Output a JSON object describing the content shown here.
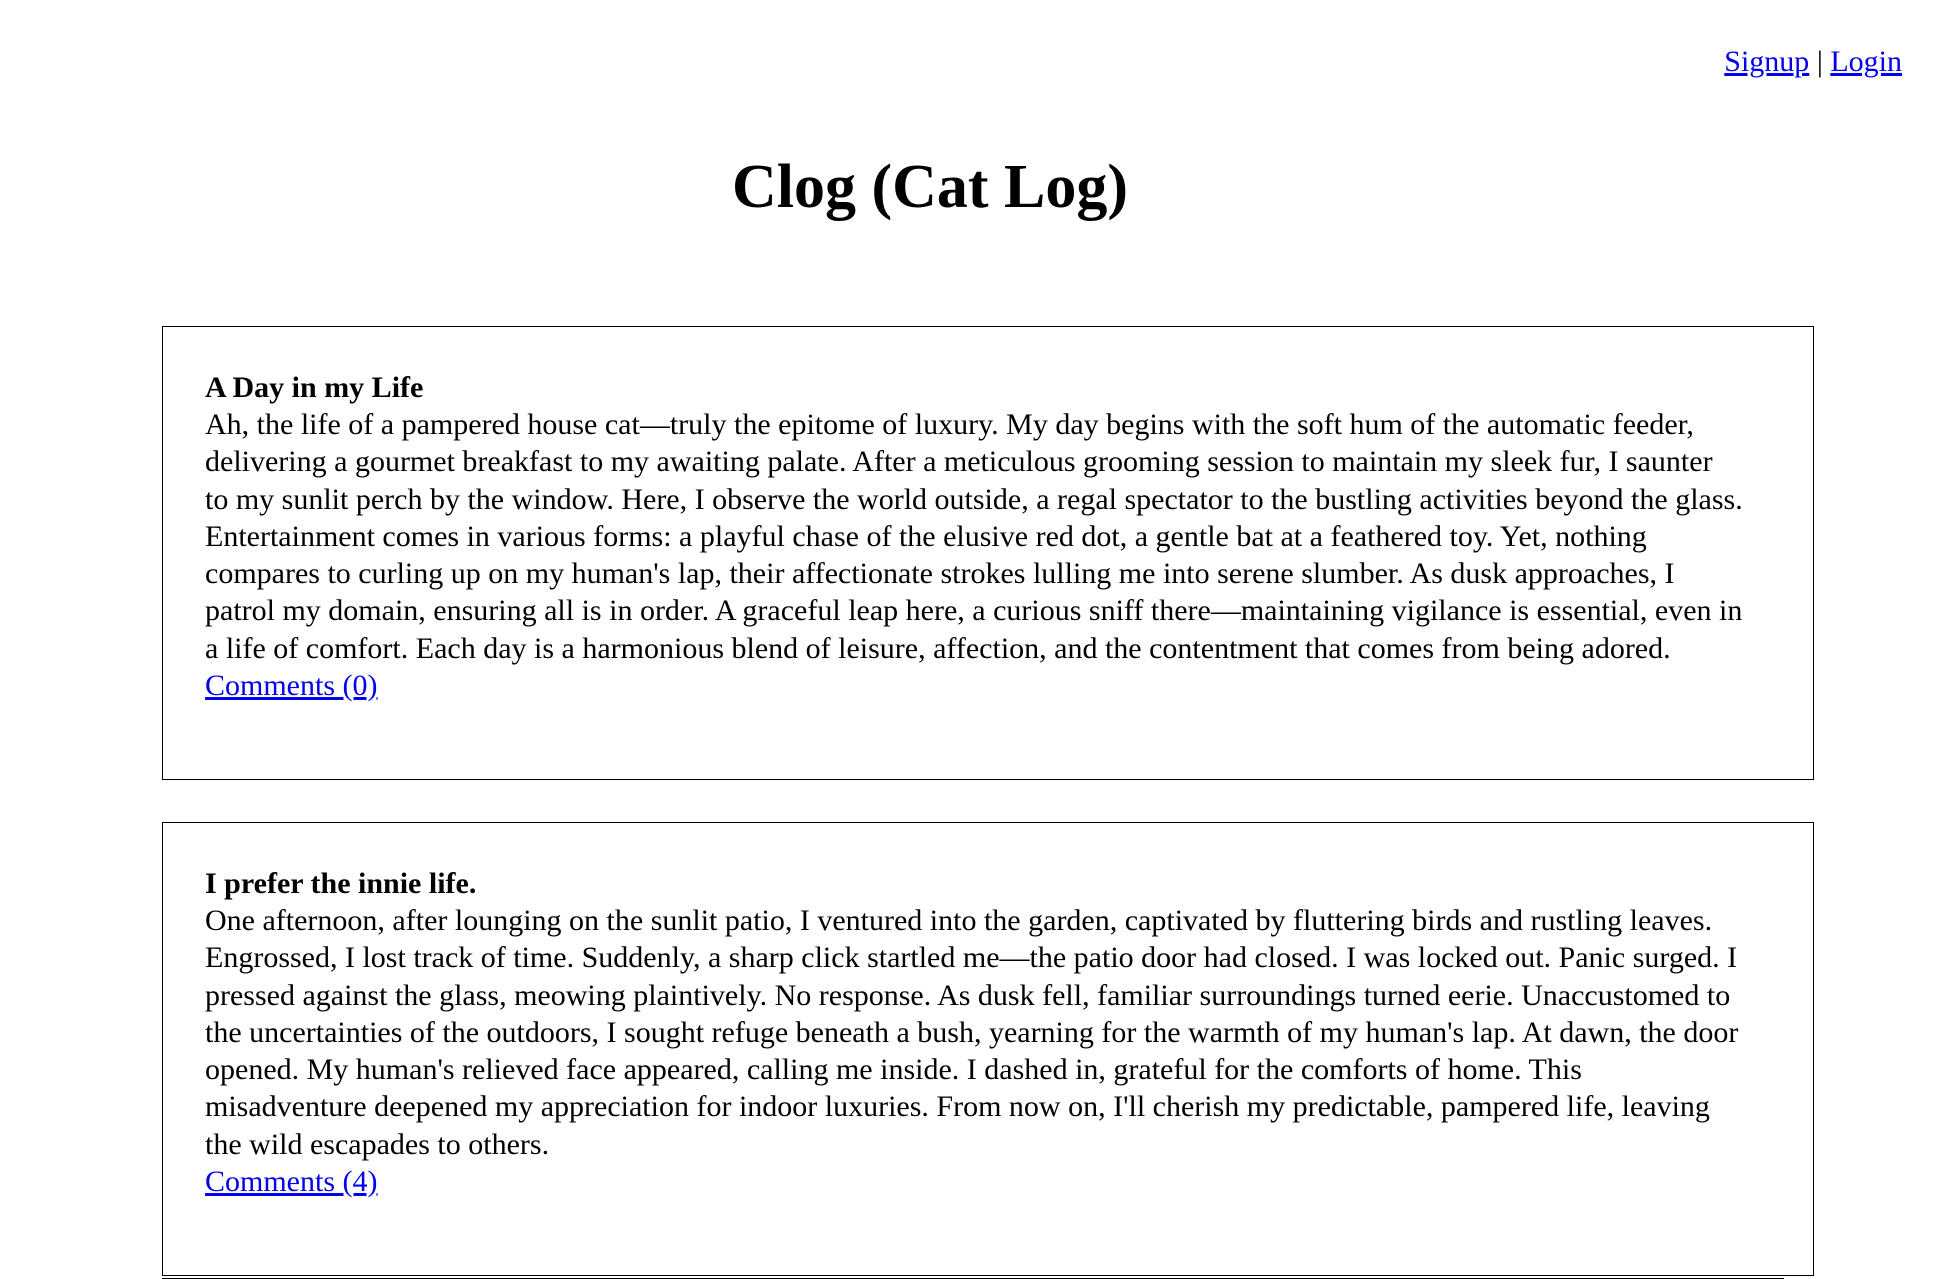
{
  "header": {
    "signup_label": "Signup",
    "separator": "|",
    "login_label": "Login"
  },
  "page": {
    "title": "Clog (Cat Log)"
  },
  "posts": [
    {
      "title": "A Day in my Life",
      "body": "Ah, the life of a pampered house cat—truly the epitome of luxury. My day begins with the soft hum of the automatic feeder, delivering a gourmet breakfast to my awaiting palate. After a meticulous grooming session to maintain my sleek fur, I saunter to my sunlit perch by the window. Here, I observe the world outside, a regal spectator to the bustling activities beyond the glass. Entertainment comes in various forms: a playful chase of the elusive red dot, a gentle bat at a feathered toy. Yet, nothing compares to curling up on my human's lap, their affectionate strokes lulling me into serene slumber. As dusk approaches, I patrol my domain, ensuring all is in order. A graceful leap here, a curious sniff there—maintaining vigilance is essential, even in a life of comfort. Each day is a harmonious blend of leisure, affection, and the contentment that comes from being adored.",
      "comments_label": "Comments (0)"
    },
    {
      "title": "I prefer the innie life.",
      "body": "One afternoon, after lounging on the sunlit patio, I ventured into the garden, captivated by fluttering birds and rustling leaves. Engrossed, I lost track of time. Suddenly, a sharp click startled me—the patio door had closed. I was locked out. Panic surged. I pressed against the glass, meowing plaintively. No response. As dusk fell, familiar surroundings turned eerie. Unaccustomed to the uncertainties of the outdoors, I sought refuge beneath a bush, yearning for the warmth of my human's lap. At dawn, the door opened. My human's relieved face appeared, calling me inside. I dashed in, grateful for the comforts of home. This misadventure deepened my appreciation for indoor luxuries. From now on, I'll cherish my predictable, pampered life, leaving the wild escapades to others.",
      "comments_label": "Comments (4)"
    }
  ]
}
